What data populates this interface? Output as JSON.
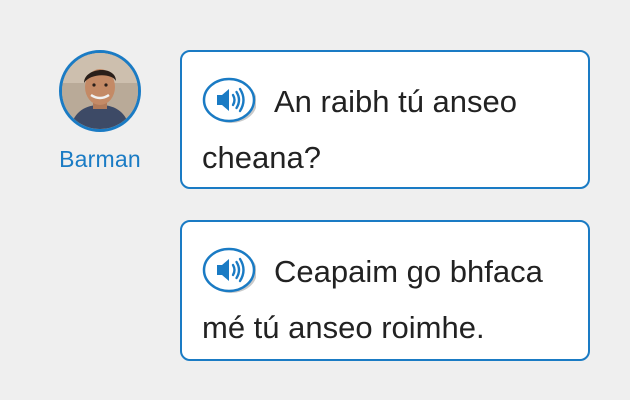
{
  "speaker": {
    "name": "Barman"
  },
  "messages": [
    {
      "text": "An raibh tú anseo cheana?",
      "icon": "speaker-icon"
    },
    {
      "text": "Ceapaim go bhfaca mé tú anseo roimhe.",
      "icon": "speaker-icon"
    }
  ],
  "colors": {
    "accent": "#1a7bc4",
    "background": "#efefef",
    "bubble": "#ffffff",
    "text": "#222222"
  }
}
